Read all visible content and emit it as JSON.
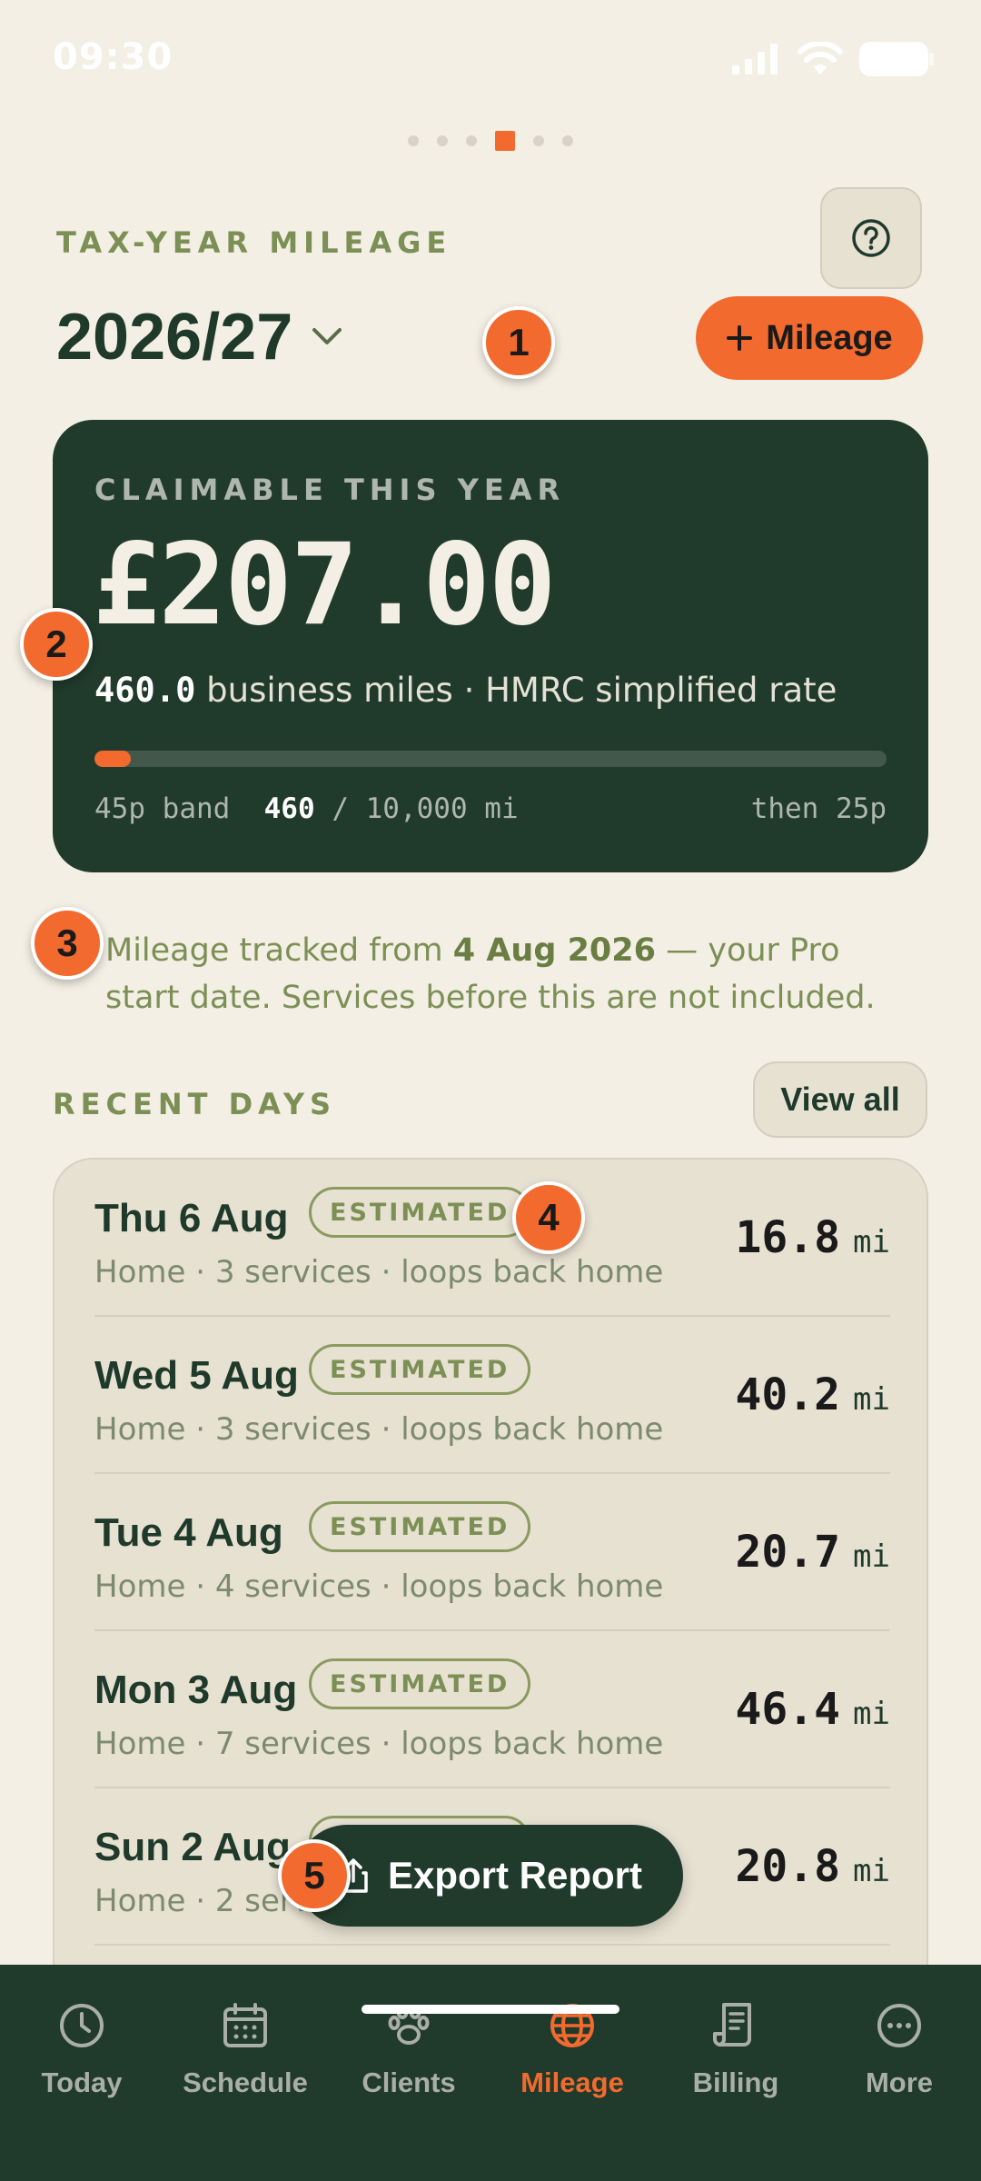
{
  "status_bar": {
    "time": "09:30"
  },
  "page_dots": {
    "count": 6,
    "active_index": 3
  },
  "header": {
    "eyebrow": "TAX-YEAR MILEAGE",
    "year": "2026/27",
    "add_button_label": "Mileage"
  },
  "summary": {
    "label": "CLAIMABLE THIS YEAR",
    "amount": "£207.00",
    "miles": "460.0",
    "miles_suffix": "business miles · HMRC simplified rate",
    "progress_fraction": 0.046,
    "band_label": "45p band",
    "band_used": "460",
    "band_total": "/ 10,000 mi",
    "band_after": "then 25p"
  },
  "note": {
    "prefix": "Mileage tracked from ",
    "date": "4 Aug 2026",
    "suffix": " — your Pro start date. Services before this are not included."
  },
  "recent": {
    "label": "RECENT DAYS",
    "view_all_label": "View all",
    "rows": [
      {
        "date": "Thu 6 Aug",
        "chip": "ESTIMATED",
        "meta": "Home · 3 services · loops back home",
        "miles": "16.8",
        "unit": "mi"
      },
      {
        "date": "Wed 5 Aug",
        "chip": "ESTIMATED",
        "meta": "Home · 3 services · loops back home",
        "miles": "40.2",
        "unit": "mi"
      },
      {
        "date": "Tue 4 Aug",
        "chip": "ESTIMATED",
        "meta": "Home · 4 services · loops back home",
        "miles": "20.7",
        "unit": "mi"
      },
      {
        "date": "Mon 3 Aug",
        "chip": "ESTIMATED",
        "meta": "Home · 7 services · loops back home",
        "miles": "46.4",
        "unit": "mi"
      },
      {
        "date": "Sun 2 Aug",
        "chip": "ESTIMATED",
        "meta": "Home · 2 services · loops back home",
        "miles": "20.8",
        "unit": "mi"
      }
    ]
  },
  "export_button_label": "Export Report",
  "badges": [
    "1",
    "2",
    "3",
    "4",
    "5"
  ],
  "nav": {
    "items": [
      {
        "label": "Today",
        "icon": "clock-icon"
      },
      {
        "label": "Schedule",
        "icon": "calendar-icon"
      },
      {
        "label": "Clients",
        "icon": "paw-icon"
      },
      {
        "label": "Mileage",
        "icon": "globe-icon",
        "active": true
      },
      {
        "label": "Billing",
        "icon": "receipt-icon"
      },
      {
        "label": "More",
        "icon": "more-icon"
      }
    ]
  },
  "colors": {
    "accent": "#f26a2e",
    "dark_green": "#203a2b",
    "background": "#f3efe4",
    "olive": "#7c8f55"
  }
}
